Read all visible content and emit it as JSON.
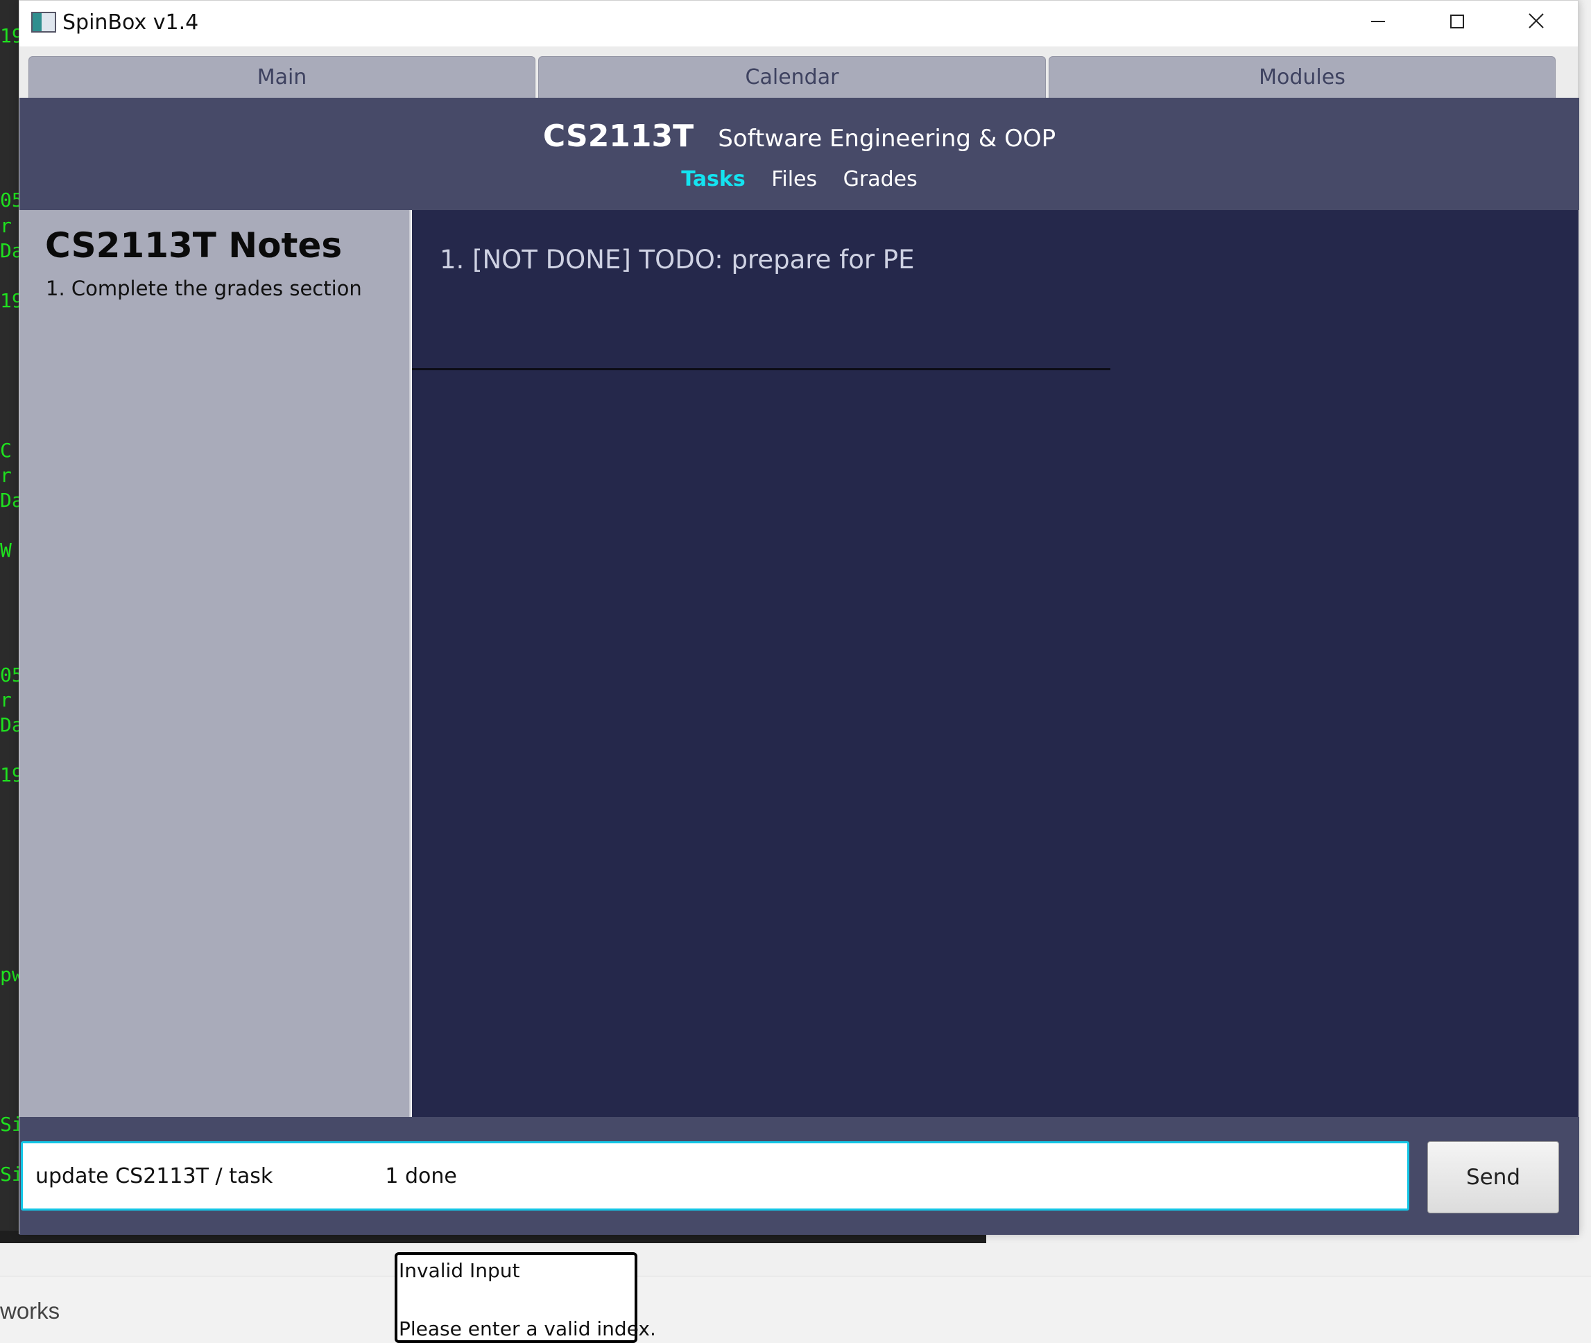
{
  "background_terminal": {
    "fragments": [
      "19",
      "05",
      "r",
      "Da",
      "19",
      "C",
      "r",
      "Da",
      "W",
      "05",
      "r",
      "Da",
      "19",
      "pw",
      "Si",
      "Si"
    ]
  },
  "window": {
    "title": "SpinBox v1.4",
    "icon": "app-icon",
    "controls": {
      "minimize_icon": "minimize-icon",
      "maximize_icon": "maximize-icon",
      "close_icon": "close-icon"
    }
  },
  "tabs": [
    {
      "label": "Main"
    },
    {
      "label": "Calendar"
    },
    {
      "label": "Modules"
    }
  ],
  "module": {
    "code": "CS2113T",
    "name": "Software Engineering & OOP",
    "subtabs": [
      {
        "label": "Tasks",
        "active": true
      },
      {
        "label": "Files",
        "active": false
      },
      {
        "label": "Grades",
        "active": false
      }
    ]
  },
  "notes": {
    "title": "CS2113T Notes",
    "items": [
      "1. Complete the grades section"
    ]
  },
  "tasks": {
    "items": [
      "1. [NOT DONE] TODO: prepare for PE"
    ]
  },
  "command": {
    "value": "update CS2113T / task                 1 done",
    "send_label": "Send"
  },
  "taskbar": {
    "text": "works"
  },
  "popup": {
    "title": "Invalid Input",
    "message": "Please enter a valid index."
  },
  "colors": {
    "header_bg": "#474a68",
    "tasks_bg": "#25284b",
    "notes_bg": "#a9abba",
    "active_subtab": "#14e3f0",
    "terminal_text": "#1fe01f"
  }
}
